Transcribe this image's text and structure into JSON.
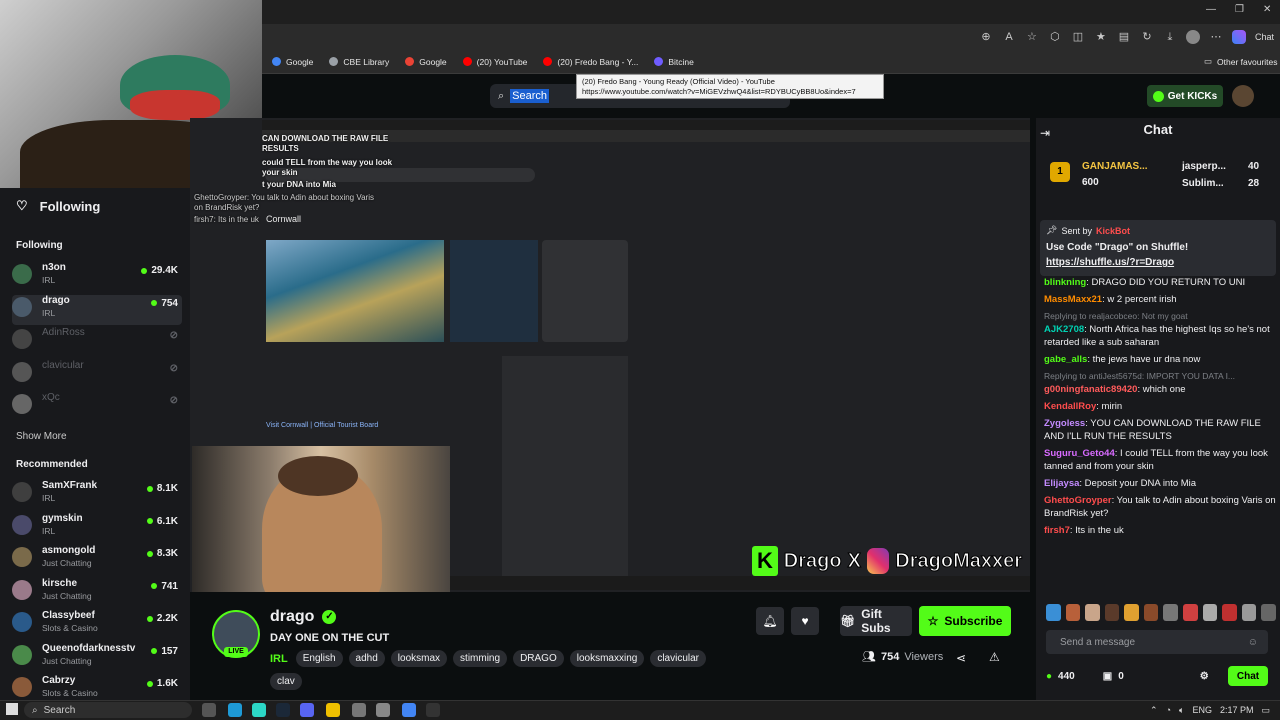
{
  "browser": {
    "bookmarks": [
      {
        "label": "Google",
        "color": "#4285f4"
      },
      {
        "label": "CBE Library",
        "color": "#9aa0a6"
      },
      {
        "label": "Google",
        "color": "#ea4335"
      },
      {
        "label": "(20) YouTube",
        "color": "#ff0000"
      },
      {
        "label": "(20) Fredo Bang - Y...",
        "color": "#ff0000"
      },
      {
        "label": "Bitcine",
        "color": "#6f5cff"
      }
    ],
    "other_favourites": "Other favourites",
    "chat_label": "Chat",
    "tooltip_line1": "(20) Fredo Bang - Young Ready (Official Video) - YouTube",
    "tooltip_line2": "https://www.youtube.com/watch?v=MiGEVzhwQ4&list=RDYBUCyBB8Uo&index=7"
  },
  "header": {
    "search_text": "Search",
    "get_kicks": "Get KICKs"
  },
  "sidebar": {
    "following_title": "Following",
    "following_section": "Following",
    "following": [
      {
        "name": "n3on",
        "sub": "IRL",
        "viewers": "29.4K",
        "live": true,
        "color": "#3a6b4a"
      },
      {
        "name": "drago",
        "sub": "IRL",
        "viewers": "754",
        "live": true,
        "color": "#4a5a6a"
      },
      {
        "name": "AdinRoss",
        "sub": "",
        "viewers": "",
        "live": false,
        "color": "#444"
      },
      {
        "name": "clavicular",
        "sub": "",
        "viewers": "",
        "live": false,
        "color": "#555"
      },
      {
        "name": "xQc",
        "sub": "",
        "viewers": "",
        "live": false,
        "color": "#666"
      }
    ],
    "show_more": "Show More",
    "recommended_section": "Recommended",
    "recommended": [
      {
        "name": "SamXFrank",
        "sub": "IRL",
        "viewers": "8.1K",
        "color": "#3f3f3f"
      },
      {
        "name": "gymskin",
        "sub": "IRL",
        "viewers": "6.1K",
        "color": "#4a4a6a"
      },
      {
        "name": "asmongold",
        "sub": "Just Chatting",
        "viewers": "8.3K",
        "color": "#7a6a4a"
      },
      {
        "name": "kirsche",
        "sub": "Just Chatting",
        "viewers": "741",
        "color": "#9a7a8a"
      },
      {
        "name": "Classybeef",
        "sub": "Slots & Casino",
        "viewers": "2.2K",
        "color": "#2a5a8a"
      },
      {
        "name": "Queenofdarknesstv",
        "sub": "Just Chatting",
        "viewers": "157",
        "color": "#4a8a4a"
      },
      {
        "name": "Cabrzy",
        "sub": "Slots & Casino",
        "viewers": "1.6K",
        "color": "#8a5a3a"
      }
    ]
  },
  "stream": {
    "overlay_lines": [
      "CAN DOWNLOAD THE RAW FILE",
      "RESULTS",
      "could TELL from the way you look",
      "your skin",
      "t your DNA into Mia",
      "GhettoGroyper: You talk to Adin about boxing Varis",
      "on BrandRisk yet?",
      "firsh7: Its in the uk"
    ],
    "serp_title": "Cornwall",
    "serp_link": "Visit Cornwall | Official Tourist Board",
    "watermark_left": "Drago",
    "watermark_x": "X",
    "watermark_right": "DragoMaxxer"
  },
  "channel": {
    "name": "drago",
    "live_label": "LIVE",
    "title": "DAY ONE ON THE CUT",
    "category": "IRL",
    "tags": [
      "English",
      "adhd",
      "looksmax",
      "stimming",
      "DRAGO",
      "looksmaxxing",
      "clavicular",
      "clav"
    ],
    "gift_subs": "Gift Subs",
    "subscribe": "Subscribe",
    "viewers_count": "754",
    "viewers_label": "Viewers"
  },
  "chat": {
    "title": "Chat",
    "leaderboard": [
      {
        "name": "GANJAMAS...",
        "value": "600"
      },
      {
        "name": "jasperp...",
        "value": "40"
      },
      {
        "name": "Sublim...",
        "value": "28"
      }
    ],
    "pinned_by_label": "Sent by",
    "pinned_by": "KickBot",
    "pinned_msg": "Use Code \"Drago\" on Shuffle!",
    "pinned_url": "https://shuffle.us/?r=Drago",
    "messages": [
      {
        "reply": "",
        "user": "blinkning",
        "color": "#53fc18",
        "text": "DRAGO DID YOU RETURN TO UNI"
      },
      {
        "reply": "",
        "user": "MassMaxx21",
        "color": "#ff8c00",
        "text": "w 2 percent irish"
      },
      {
        "reply": "Replying to realjacobceo: Not my goat",
        "user": "AJK2708",
        "color": "#00d1b2",
        "text": "North Africa has the highest Iqs so he's not retarded like a sub saharan"
      },
      {
        "reply": "",
        "user": "gabe_alls",
        "color": "#53fc18",
        "text": "the jews have ur dna now"
      },
      {
        "reply": "Replying to antiJest5675d: IMPORT YOU DATA I...",
        "user": "g00ningfanatic89420",
        "color": "#ff5b5b",
        "text": "which one"
      },
      {
        "reply": "",
        "user": "KendallRoy",
        "color": "#ff4d4d",
        "text": "mirin"
      },
      {
        "reply": "",
        "user": "Zygoless",
        "color": "#c38bff",
        "text": "YOU CAN DOWNLOAD THE RAW FILE AND I'LL RUN THE RESULTS"
      },
      {
        "reply": "",
        "user": "Suguru_Geto44",
        "color": "#d86bff",
        "text": "I could TELL from the way you look tanned and from your skin"
      },
      {
        "reply": "",
        "user": "Elijaysa",
        "color": "#c38bff",
        "text": "Deposit your DNA into Mia"
      },
      {
        "reply": "",
        "user": "GhettoGroyper",
        "color": "#ff4d4d",
        "text": "You talk to Adin about boxing Varis on BrandRisk yet?"
      },
      {
        "reply": "",
        "user": "firsh7",
        "color": "#ff4d4d",
        "text": "Its in the uk"
      }
    ],
    "input_placeholder": "Send a message",
    "points": "440",
    "gifts": "0",
    "send_label": "Chat"
  },
  "taskbar": {
    "search_text": "Search",
    "lang": "ENG",
    "time": "2:17 PM"
  }
}
